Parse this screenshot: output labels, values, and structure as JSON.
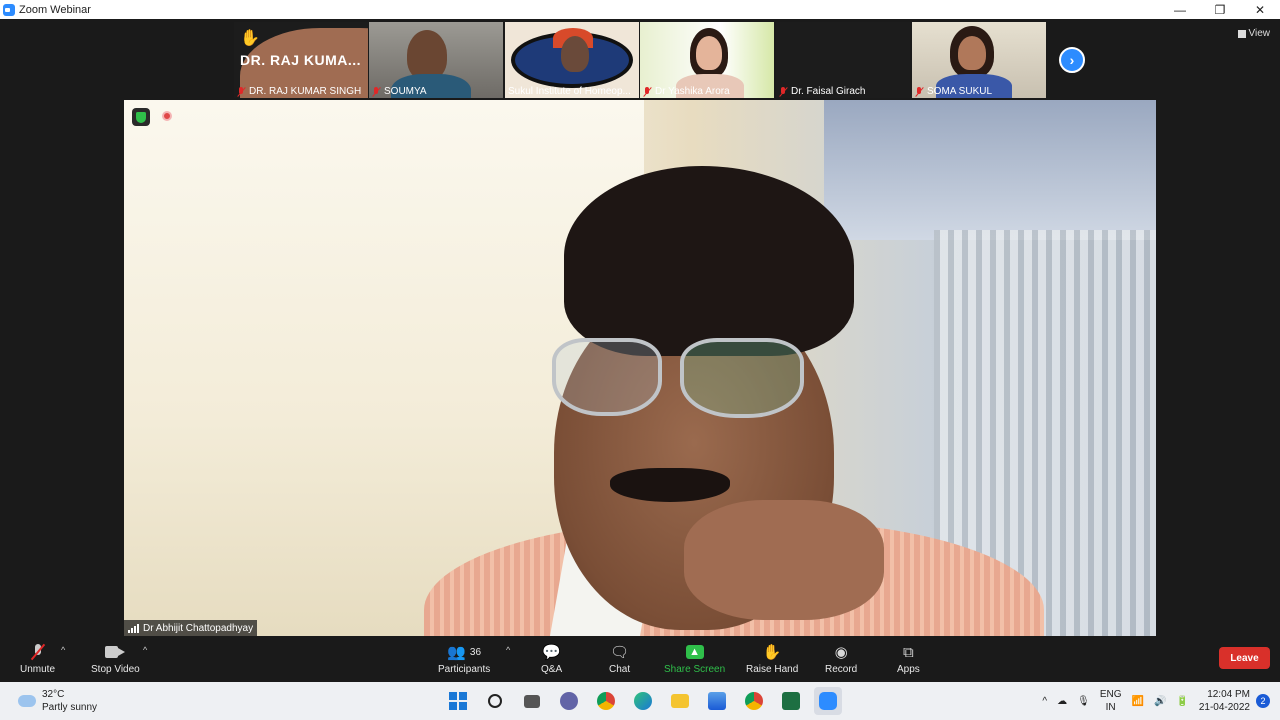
{
  "window": {
    "title": "Zoom Webinar",
    "minimize": "—",
    "maximize": "❐",
    "close": "✕"
  },
  "strip": {
    "view_label": "View",
    "next_label": "›",
    "thumbnails": [
      {
        "name": "DR. RAJ KUMAR SINGH",
        "big_name": "DR. RAJ KUMA...",
        "hand_raised": true
      },
      {
        "name": "SOUMYA"
      },
      {
        "name": "Sukul Institute of Homeop..."
      },
      {
        "name": "Dr Yashika Arora"
      },
      {
        "name": "Dr. Faisal Girach"
      },
      {
        "name": "SOMA SUKUL"
      }
    ]
  },
  "main": {
    "speaker_name": "Dr Abhijit Chattopadhyay"
  },
  "toolbar": {
    "unmute": "Unmute",
    "stop_video": "Stop Video",
    "participants": "Participants",
    "participants_count": "36",
    "qa": "Q&A",
    "chat": "Chat",
    "share_screen": "Share Screen",
    "raise_hand": "Raise Hand",
    "record": "Record",
    "apps": "Apps",
    "leave": "Leave",
    "caret": "^"
  },
  "taskbar": {
    "temperature": "32°C",
    "weather": "Partly sunny",
    "lang_top": "ENG",
    "lang_bottom": "IN",
    "time": "12:04 PM",
    "date": "21-04-2022",
    "notification_count": "2",
    "overflow": "^"
  },
  "colors": {
    "accent": "#2d8cff",
    "leave": "#d9302a",
    "share": "#2fbf4a",
    "muted": "#e02828"
  }
}
